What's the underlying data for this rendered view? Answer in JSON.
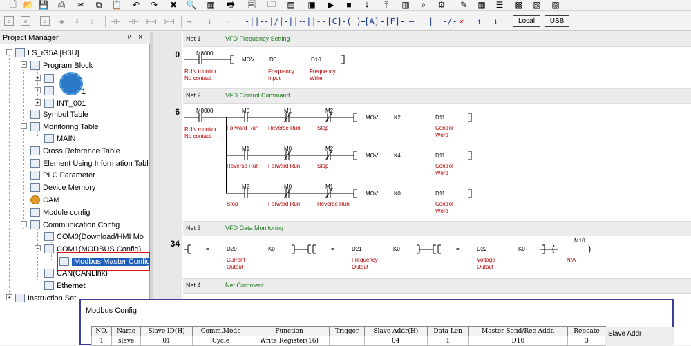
{
  "toolbar": {
    "buttons": {
      "local": "Local",
      "usb": "USB"
    }
  },
  "project_manager": {
    "title": "Project Manager",
    "pin": "ᵖ",
    "close": "×",
    "items": [
      {
        "label": "LS_iG5A [H3U]"
      },
      {
        "label": "Program Block"
      },
      {
        "label": "1"
      },
      {
        "label": "INT_001"
      },
      {
        "label": "Symbol Table"
      },
      {
        "label": "Monitoring Table"
      },
      {
        "label": "MAIN"
      },
      {
        "label": "Cross Reference Table"
      },
      {
        "label": "Element Using Information Table"
      },
      {
        "label": "PLC Parameter"
      },
      {
        "label": "Device Memory"
      },
      {
        "label": "CAM"
      },
      {
        "label": "Module config"
      },
      {
        "label": "Communication Config"
      },
      {
        "label": "COM0(Download/HMI Mo"
      },
      {
        "label": "COM1(MODBUS Config)"
      },
      {
        "label": "Modbus Master Config"
      },
      {
        "label": "CAN(CANLink)"
      },
      {
        "label": "Ethernet"
      },
      {
        "label": "Instruction Set"
      }
    ]
  },
  "ladder": {
    "nets": [
      {
        "num": "Net 1",
        "comment": "VFD Frequency Setting",
        "step": "0"
      },
      {
        "num": "Net 2",
        "comment": "VFD Control Command",
        "step": "6"
      },
      {
        "num": "Net 3",
        "comment": "VFD Data Monitoring",
        "step": "34"
      },
      {
        "num": "Net 4",
        "comment": "Net Comment"
      }
    ],
    "net1": {
      "contact": "M8000",
      "contact_c1": "RUN monitor",
      "contact_c2": "No contact",
      "instr": "MOV",
      "op1": "D0",
      "op1_c1": "Frequency",
      "op1_c2": "Input",
      "op2": "D10",
      "op2_c1": "Frequency",
      "op2_c2": "Write"
    },
    "net2": {
      "m8000": "M8000",
      "m8000_c1": "RUN monitor",
      "m8000_c2": "No contact",
      "rows": [
        {
          "c1": "M0",
          "c1c": "Forward Run",
          "c2": "M1",
          "c2c": "Reverse Run",
          "c3": "M2",
          "c3c": "Stop",
          "instr": "MOV",
          "src": "K2",
          "dst": "D11",
          "dst_c1": "Control",
          "dst_c2": "Word"
        },
        {
          "c1": "M1",
          "c1c": "Reverse Run",
          "c2": "M0",
          "c2c": "Forward Run",
          "c3": "M2",
          "c3c": "Stop",
          "instr": "MOV",
          "src": "K4",
          "dst": "D11",
          "dst_c1": "Control",
          "dst_c2": "Word"
        },
        {
          "c1": "M2",
          "c1c": "Stop",
          "c2": "M0",
          "c2c": "Forward Run",
          "c3": "M1",
          "c3c": "Reverse Run",
          "instr": "MOV",
          "src": "K0",
          "dst": "D11",
          "dst_c1": "Control",
          "dst_c2": "Word"
        }
      ]
    },
    "net3": {
      "cmp": [
        {
          "op": "=",
          "a": "D20",
          "a_c1": "Current",
          "a_c2": "Output",
          "b": "K0"
        },
        {
          "op": "=",
          "a": "D21",
          "a_c1": "Frequency",
          "a_c2": "Output",
          "b": "K0"
        },
        {
          "op": "=",
          "a": "D22",
          "a_c1": "Voltage",
          "a_c2": "Output",
          "b": "K0"
        }
      ],
      "coil": "M10",
      "coil_c": "N/A"
    }
  },
  "modbus_dialog": {
    "title": "Modbus Config",
    "columns": [
      "NO.",
      "Name",
      "Slave ID(H)",
      "Comm.Mode",
      "Function",
      "Trigger",
      "Slave Addr(H)",
      "Data Len",
      "Master Send/Rec Addr.",
      "Repeate"
    ],
    "rows": [
      [
        "1",
        "slave",
        "01",
        "Cycle",
        "Write Register(16)",
        "",
        "04",
        "1",
        "D10",
        "3"
      ]
    ],
    "side_label": "Slave Addr"
  }
}
